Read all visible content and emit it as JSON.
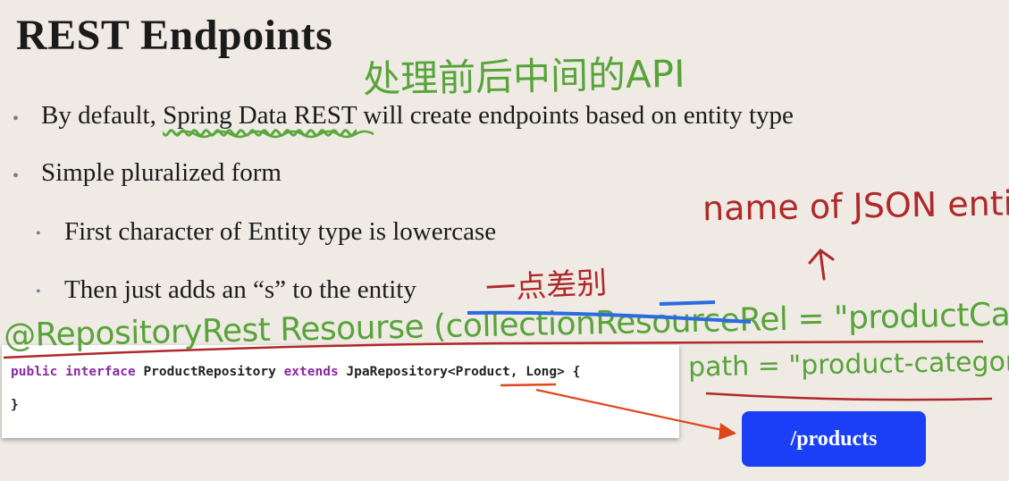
{
  "slide": {
    "title": "REST Endpoints",
    "bullets": [
      {
        "pre": "By default, ",
        "highlight": "Spring Data REST",
        "post": " will create endpoints based on entity type"
      },
      {
        "text": "Simple pluralized form"
      }
    ],
    "sub_bullets": [
      "First character of Entity type is lowercase",
      "Then just adds an “s” to the entity"
    ],
    "bullet_glyph": "•",
    "code": {
      "line1": {
        "kw1": "public",
        "kw2": "interface",
        "name": "ProductRepository",
        "kw3": "extends",
        "base": "JpaRepository<",
        "type": "Product",
        "rest": ", Long> {"
      },
      "line2": "}"
    },
    "endpoint_button": "/products"
  },
  "annotations": {
    "chinese_note": "处理前后中间的API",
    "json_note": "name of JSON entity",
    "cn_note2": "一点差别",
    "repo_annotation": "@RepositoryRest Resourse (collectionResourceRel = \"productCategory\",",
    "path_annotation": "path = \"product-category\")"
  },
  "colors": {
    "background": "#efebe4",
    "button": "#1b3ff7",
    "keyword": "#8a2aa0",
    "ink_green": "#58a43a",
    "ink_red": "#b0282a",
    "ink_blue": "#2b6be0"
  }
}
